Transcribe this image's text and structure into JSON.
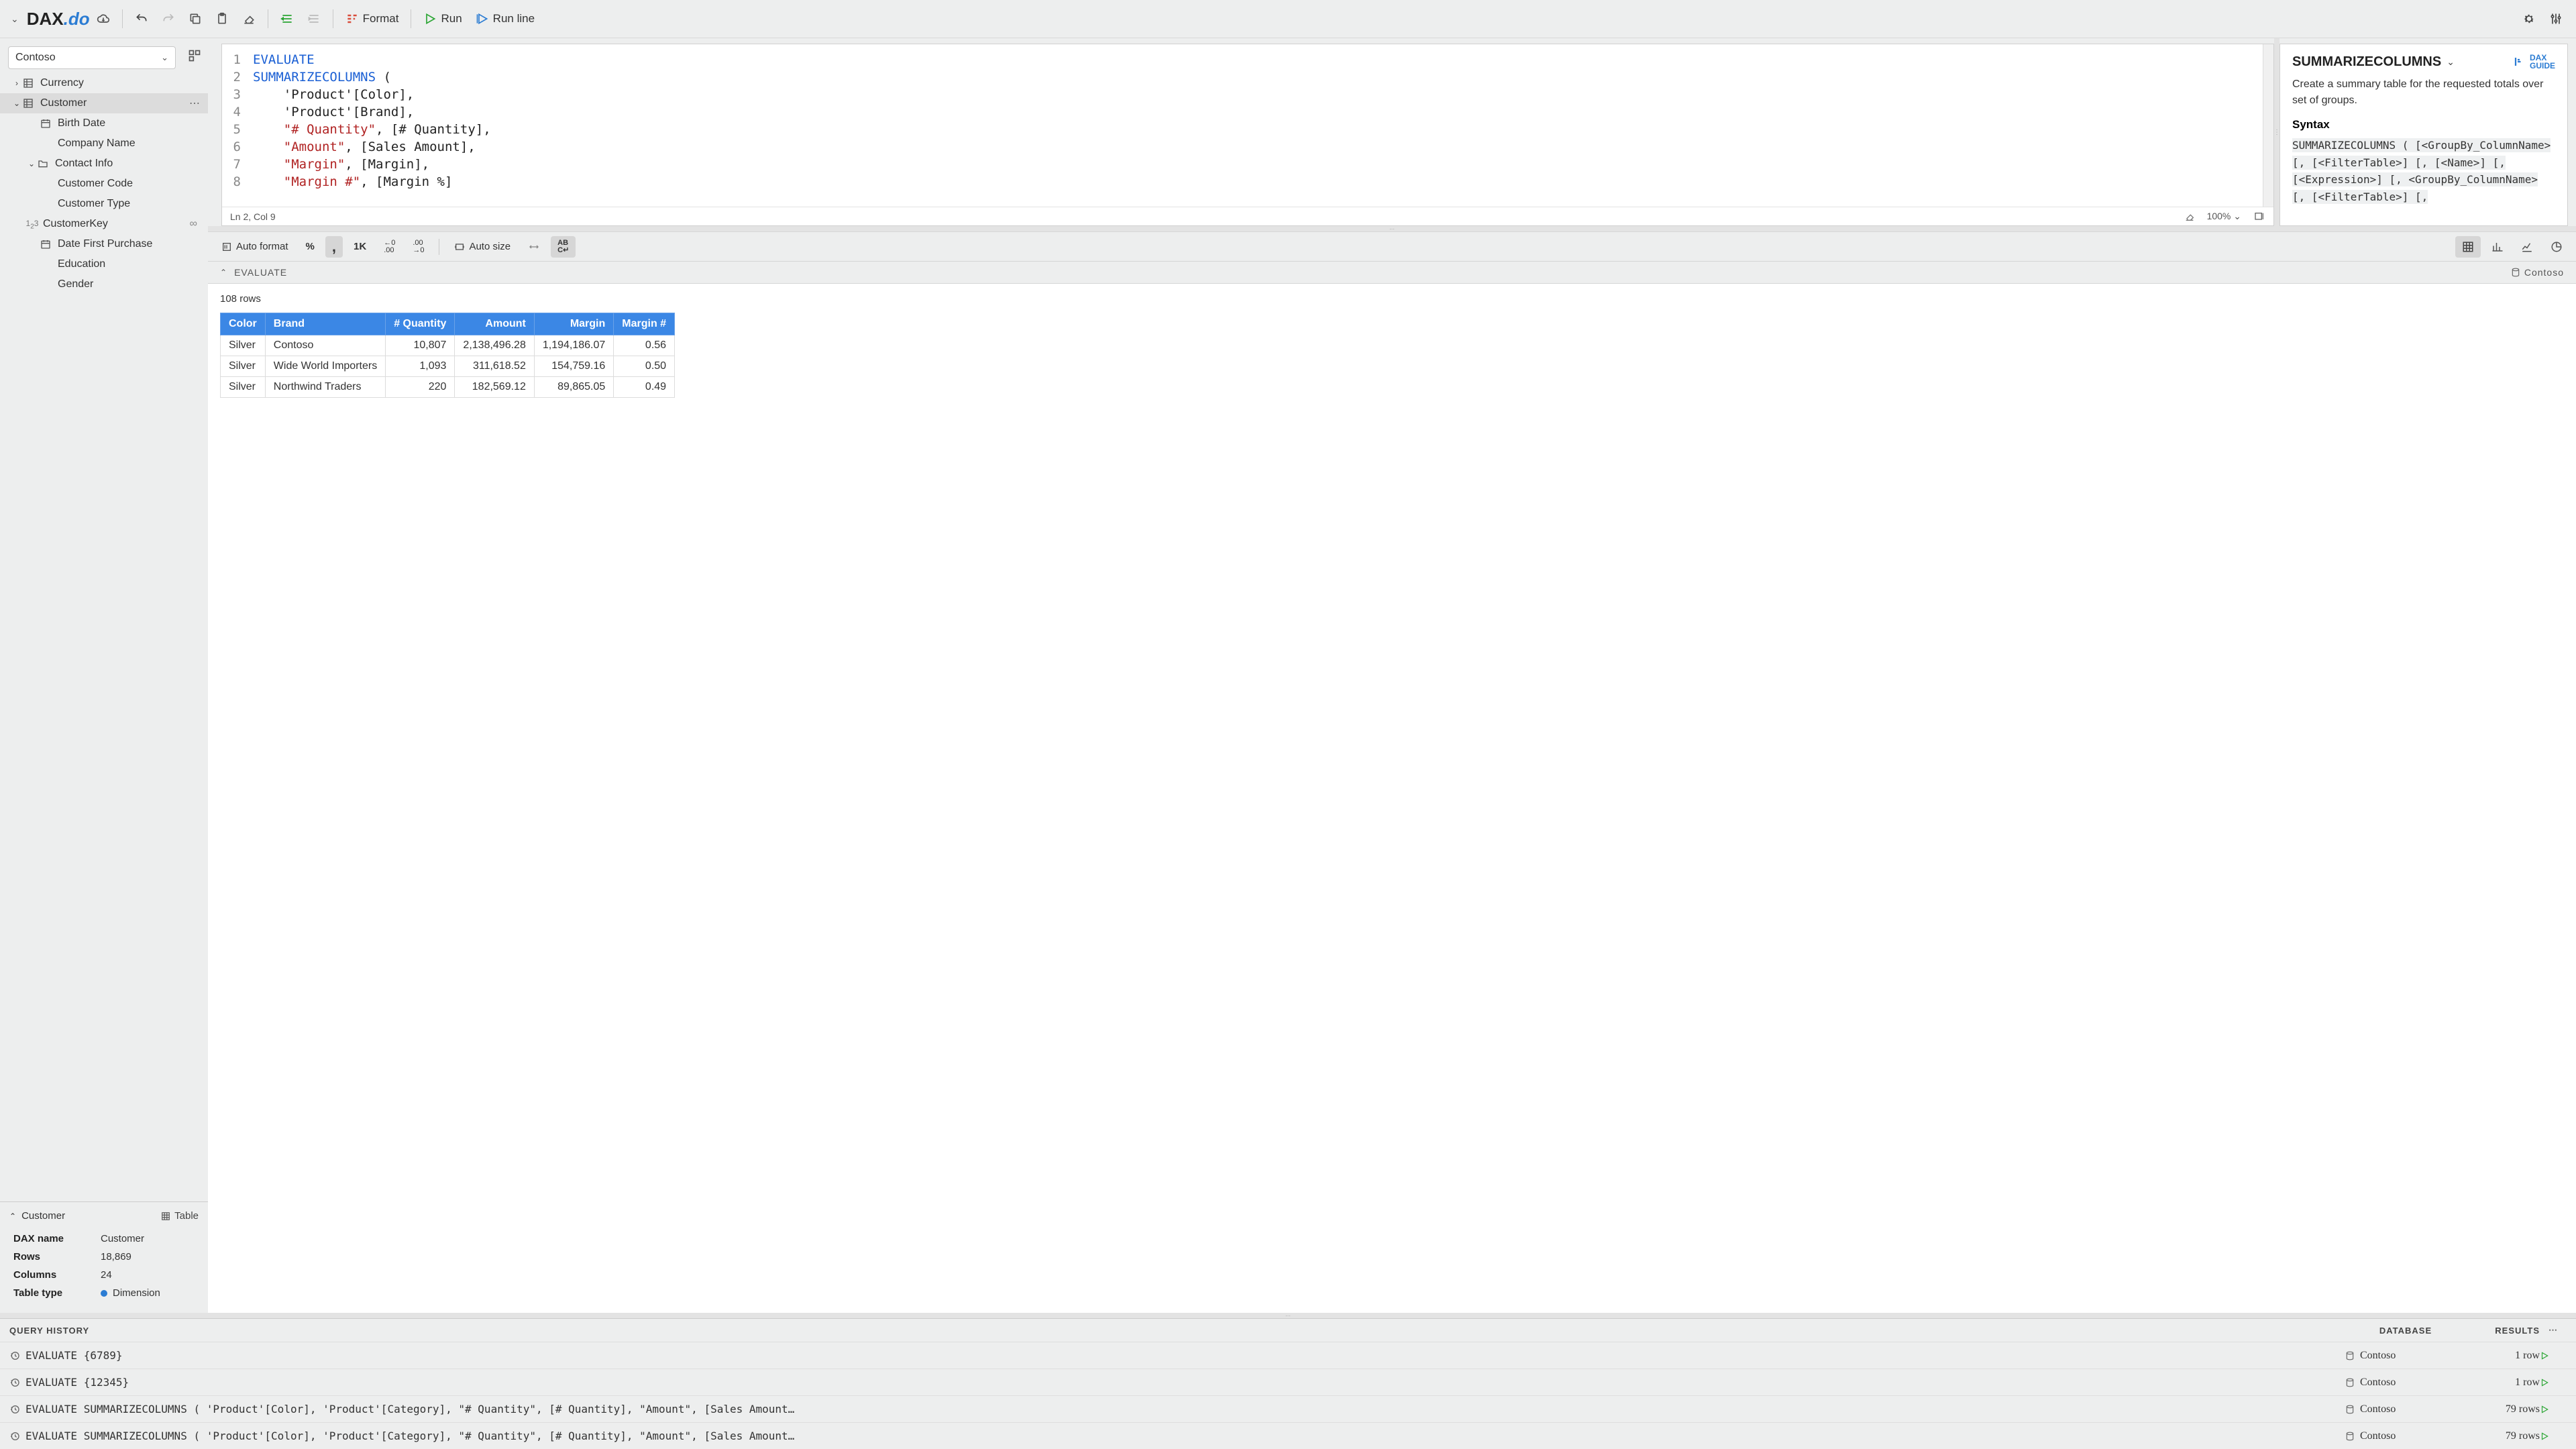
{
  "toolbar": {
    "format_label": "Format",
    "run_label": "Run",
    "run_line_label": "Run line"
  },
  "model": {
    "selected": "Contoso"
  },
  "tree": [
    {
      "label": "Currency",
      "type": "table",
      "indent": 0,
      "chev": "›"
    },
    {
      "label": "Customer",
      "type": "table",
      "indent": 0,
      "chev": "⌄",
      "selected": true,
      "more": true
    },
    {
      "label": "Birth Date",
      "type": "date",
      "indent": 2
    },
    {
      "label": "Company Name",
      "type": "text",
      "indent": 2,
      "noicon": true
    },
    {
      "label": "Contact Info",
      "type": "folder",
      "indent": 1,
      "chev": "⌄"
    },
    {
      "label": "Customer Code",
      "type": "text",
      "indent": 2,
      "noicon": true
    },
    {
      "label": "Customer Type",
      "type": "text",
      "indent": 2,
      "noicon": true
    },
    {
      "label": "CustomerKey",
      "type": "num",
      "indent": 1,
      "key": true
    },
    {
      "label": "Date First Purchase",
      "type": "date",
      "indent": 2
    },
    {
      "label": "Education",
      "type": "text",
      "indent": 2,
      "noicon": true
    },
    {
      "label": "Gender",
      "type": "text",
      "indent": 2,
      "noicon": true
    }
  ],
  "meta": {
    "title": "Customer",
    "type_label": "Table",
    "rows": [
      {
        "k": "DAX name",
        "v": "Customer"
      },
      {
        "k": "Rows",
        "v": "18,869"
      },
      {
        "k": "Columns",
        "v": "24"
      },
      {
        "k": "Table type",
        "v": "Dimension",
        "dot": true
      }
    ]
  },
  "editor": {
    "lines": [
      {
        "t": [
          [
            "kw",
            "EVALUATE"
          ]
        ]
      },
      {
        "t": [
          [
            "kw",
            "SUMMARIZECOLUMNS"
          ],
          [
            "",
            " ("
          ]
        ]
      },
      {
        "t": [
          [
            "",
            "    'Product'[Color],"
          ]
        ]
      },
      {
        "t": [
          [
            "",
            "    'Product'[Brand],"
          ]
        ]
      },
      {
        "t": [
          [
            "",
            "    "
          ],
          [
            "str",
            "\"# Quantity\""
          ],
          [
            "",
            ", [# Quantity],"
          ]
        ]
      },
      {
        "t": [
          [
            "",
            "    "
          ],
          [
            "str",
            "\"Amount\""
          ],
          [
            "",
            ", [Sales Amount],"
          ]
        ]
      },
      {
        "t": [
          [
            "",
            "    "
          ],
          [
            "str",
            "\"Margin\""
          ],
          [
            "",
            ", [Margin],"
          ]
        ]
      },
      {
        "t": [
          [
            "",
            "    "
          ],
          [
            "str",
            "\"Margin #\""
          ],
          [
            "",
            ", [Margin %]"
          ]
        ]
      }
    ],
    "status_pos": "Ln 2, Col 9",
    "zoom": "100%"
  },
  "help": {
    "title": "SUMMARIZECOLUMNS",
    "desc": "Create a summary table for the requested totals over set of groups.",
    "syntax_label": "Syntax",
    "syntax": "SUMMARIZECOLUMNS ( [<GroupBy_ColumnName> [, [<FilterTable>] [, [<Name>] [, [<Expression>] [, <GroupBy_ColumnName> [, [<FilterTable>] [,"
  },
  "results_tb": {
    "auto_format": "Auto format",
    "auto_size": "Auto size"
  },
  "results": {
    "header_label": "EVALUATE",
    "header_db": "Contoso",
    "row_count": "108 rows",
    "columns": [
      "Color",
      "Brand",
      "# Quantity",
      "Amount",
      "Margin",
      "Margin #"
    ],
    "col_align": [
      "l",
      "l",
      "r",
      "r",
      "r",
      "r"
    ],
    "rows": [
      [
        "Silver",
        "Contoso",
        "10,807",
        "2,138,496.28",
        "1,194,186.07",
        "0.56"
      ],
      [
        "Silver",
        "Wide World Importers",
        "1,093",
        "311,618.52",
        "154,759.16",
        "0.50"
      ],
      [
        "Silver",
        "Northwind Traders",
        "220",
        "182,569.12",
        "89,865.05",
        "0.49"
      ]
    ]
  },
  "history": {
    "title": "QUERY HISTORY",
    "col_db": "DATABASE",
    "col_res": "RESULTS",
    "items": [
      {
        "q": "EVALUATE {6789}",
        "db": "Contoso",
        "res": "1 row"
      },
      {
        "q": "EVALUATE {12345}",
        "db": "Contoso",
        "res": "1 row"
      },
      {
        "q": "EVALUATE SUMMARIZECOLUMNS ( 'Product'[Color], 'Product'[Category], \"# Quantity\", [# Quantity], \"Amount\", [Sales Amount…",
        "db": "Contoso",
        "res": "79 rows"
      },
      {
        "q": "EVALUATE SUMMARIZECOLUMNS ( 'Product'[Color], 'Product'[Category], \"# Quantity\", [# Quantity], \"Amount\", [Sales Amount…",
        "db": "Contoso",
        "res": "79 rows"
      }
    ]
  }
}
